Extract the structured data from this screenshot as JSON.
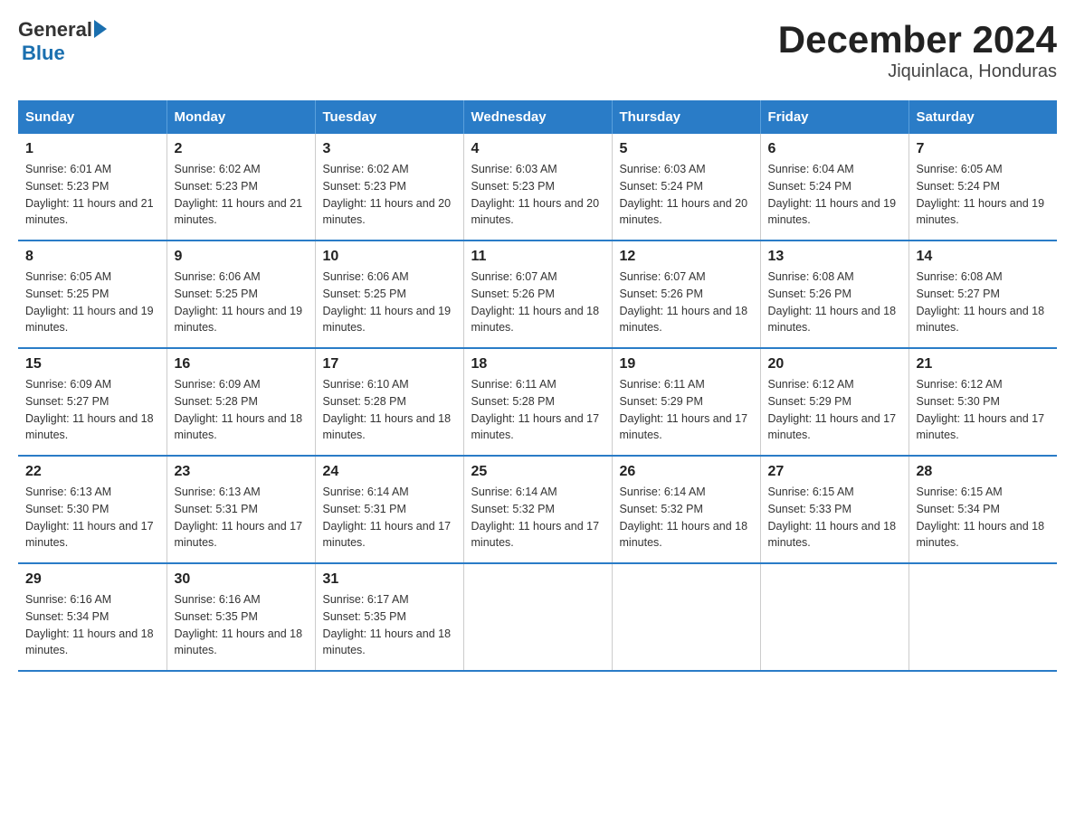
{
  "header": {
    "logo_text_general": "General",
    "logo_text_blue": "Blue",
    "title": "December 2024",
    "subtitle": "Jiquinlaca, Honduras"
  },
  "days_of_week": [
    "Sunday",
    "Monday",
    "Tuesday",
    "Wednesday",
    "Thursday",
    "Friday",
    "Saturday"
  ],
  "weeks": [
    [
      {
        "day": "1",
        "sunrise": "6:01 AM",
        "sunset": "5:23 PM",
        "daylight": "11 hours and 21 minutes."
      },
      {
        "day": "2",
        "sunrise": "6:02 AM",
        "sunset": "5:23 PM",
        "daylight": "11 hours and 21 minutes."
      },
      {
        "day": "3",
        "sunrise": "6:02 AM",
        "sunset": "5:23 PM",
        "daylight": "11 hours and 20 minutes."
      },
      {
        "day": "4",
        "sunrise": "6:03 AM",
        "sunset": "5:23 PM",
        "daylight": "11 hours and 20 minutes."
      },
      {
        "day": "5",
        "sunrise": "6:03 AM",
        "sunset": "5:24 PM",
        "daylight": "11 hours and 20 minutes."
      },
      {
        "day": "6",
        "sunrise": "6:04 AM",
        "sunset": "5:24 PM",
        "daylight": "11 hours and 19 minutes."
      },
      {
        "day": "7",
        "sunrise": "6:05 AM",
        "sunset": "5:24 PM",
        "daylight": "11 hours and 19 minutes."
      }
    ],
    [
      {
        "day": "8",
        "sunrise": "6:05 AM",
        "sunset": "5:25 PM",
        "daylight": "11 hours and 19 minutes."
      },
      {
        "day": "9",
        "sunrise": "6:06 AM",
        "sunset": "5:25 PM",
        "daylight": "11 hours and 19 minutes."
      },
      {
        "day": "10",
        "sunrise": "6:06 AM",
        "sunset": "5:25 PM",
        "daylight": "11 hours and 19 minutes."
      },
      {
        "day": "11",
        "sunrise": "6:07 AM",
        "sunset": "5:26 PM",
        "daylight": "11 hours and 18 minutes."
      },
      {
        "day": "12",
        "sunrise": "6:07 AM",
        "sunset": "5:26 PM",
        "daylight": "11 hours and 18 minutes."
      },
      {
        "day": "13",
        "sunrise": "6:08 AM",
        "sunset": "5:26 PM",
        "daylight": "11 hours and 18 minutes."
      },
      {
        "day": "14",
        "sunrise": "6:08 AM",
        "sunset": "5:27 PM",
        "daylight": "11 hours and 18 minutes."
      }
    ],
    [
      {
        "day": "15",
        "sunrise": "6:09 AM",
        "sunset": "5:27 PM",
        "daylight": "11 hours and 18 minutes."
      },
      {
        "day": "16",
        "sunrise": "6:09 AM",
        "sunset": "5:28 PM",
        "daylight": "11 hours and 18 minutes."
      },
      {
        "day": "17",
        "sunrise": "6:10 AM",
        "sunset": "5:28 PM",
        "daylight": "11 hours and 18 minutes."
      },
      {
        "day": "18",
        "sunrise": "6:11 AM",
        "sunset": "5:28 PM",
        "daylight": "11 hours and 17 minutes."
      },
      {
        "day": "19",
        "sunrise": "6:11 AM",
        "sunset": "5:29 PM",
        "daylight": "11 hours and 17 minutes."
      },
      {
        "day": "20",
        "sunrise": "6:12 AM",
        "sunset": "5:29 PM",
        "daylight": "11 hours and 17 minutes."
      },
      {
        "day": "21",
        "sunrise": "6:12 AM",
        "sunset": "5:30 PM",
        "daylight": "11 hours and 17 minutes."
      }
    ],
    [
      {
        "day": "22",
        "sunrise": "6:13 AM",
        "sunset": "5:30 PM",
        "daylight": "11 hours and 17 minutes."
      },
      {
        "day": "23",
        "sunrise": "6:13 AM",
        "sunset": "5:31 PM",
        "daylight": "11 hours and 17 minutes."
      },
      {
        "day": "24",
        "sunrise": "6:14 AM",
        "sunset": "5:31 PM",
        "daylight": "11 hours and 17 minutes."
      },
      {
        "day": "25",
        "sunrise": "6:14 AM",
        "sunset": "5:32 PM",
        "daylight": "11 hours and 17 minutes."
      },
      {
        "day": "26",
        "sunrise": "6:14 AM",
        "sunset": "5:32 PM",
        "daylight": "11 hours and 18 minutes."
      },
      {
        "day": "27",
        "sunrise": "6:15 AM",
        "sunset": "5:33 PM",
        "daylight": "11 hours and 18 minutes."
      },
      {
        "day": "28",
        "sunrise": "6:15 AM",
        "sunset": "5:34 PM",
        "daylight": "11 hours and 18 minutes."
      }
    ],
    [
      {
        "day": "29",
        "sunrise": "6:16 AM",
        "sunset": "5:34 PM",
        "daylight": "11 hours and 18 minutes."
      },
      {
        "day": "30",
        "sunrise": "6:16 AM",
        "sunset": "5:35 PM",
        "daylight": "11 hours and 18 minutes."
      },
      {
        "day": "31",
        "sunrise": "6:17 AM",
        "sunset": "5:35 PM",
        "daylight": "11 hours and 18 minutes."
      },
      null,
      null,
      null,
      null
    ]
  ]
}
